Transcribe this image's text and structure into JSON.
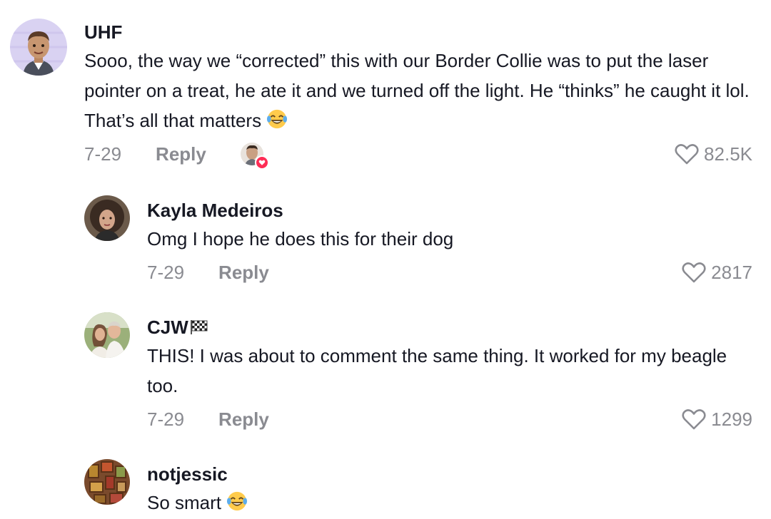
{
  "comments": [
    {
      "username": "UHF",
      "text": "Sooo, the way we “corrected” this with our Border Collie was to put the laser pointer on a treat, he ate it and we turned off the light. He “thinks” he caught it lol. That’s all that matters",
      "date": "7-29",
      "reply_label": "Reply",
      "likes": "82.5K",
      "emoji": "laughing-tears-emoji",
      "liked_by_creator": true
    },
    {
      "username": "Kayla Medeiros",
      "text": "Omg I hope he does this for their dog",
      "date": "7-29",
      "reply_label": "Reply",
      "likes": "2817"
    },
    {
      "username": "CJW",
      "username_icon": "checkered-flag-icon",
      "text": "THIS! I was about to comment the same thing. It worked for my beagle too.",
      "date": "7-29",
      "reply_label": "Reply",
      "likes": "1299"
    },
    {
      "username": "notjessic",
      "text": "So smart",
      "emoji": "laughing-tears-emoji"
    }
  ],
  "colors": {
    "text": "#161823",
    "meta": "#8a8b91",
    "accent": "#fe2c55"
  }
}
